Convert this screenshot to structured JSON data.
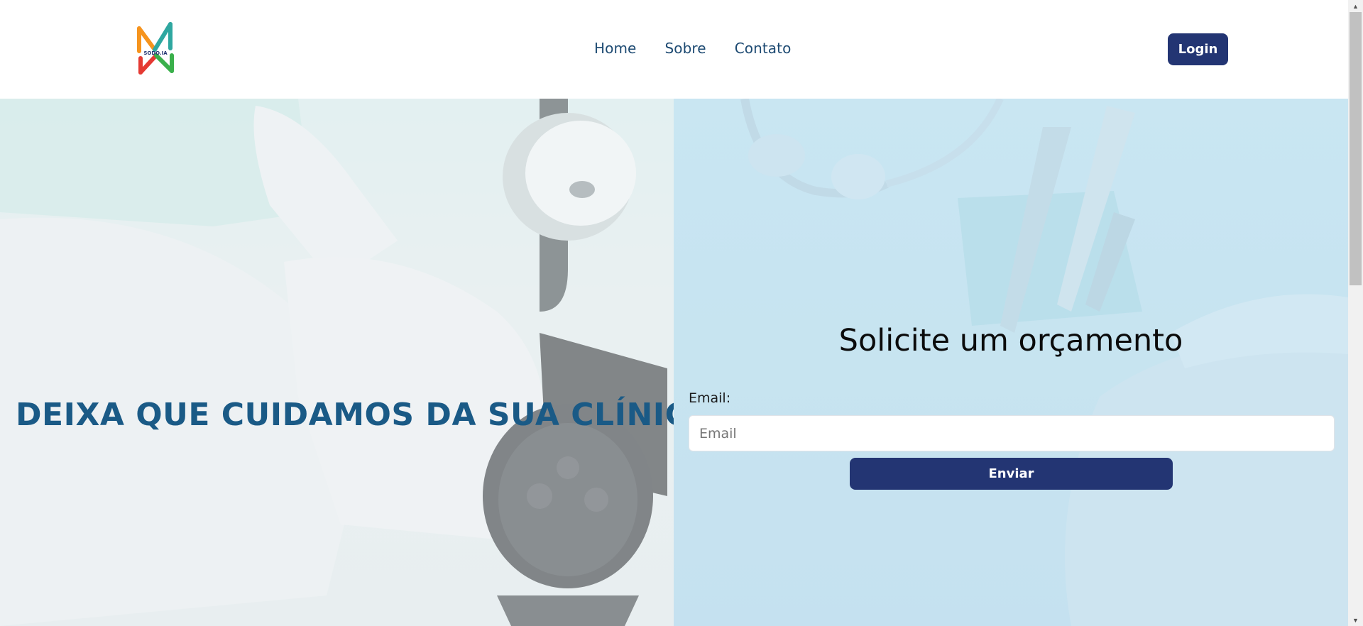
{
  "header": {
    "logo_text": "SODO.IA",
    "nav": [
      "Home",
      "Sobre",
      "Contato"
    ],
    "login_label": "Login"
  },
  "hero": {
    "headline": "DEIXA QUE CUIDAMOS DA SUA CLÍNICA!"
  },
  "quote_form": {
    "title": "Solicite um orçamento",
    "email_label": "Email:",
    "email_placeholder": "Email",
    "email_value": "",
    "submit_label": "Enviar"
  },
  "colors": {
    "brand_navy": "#233573",
    "nav_text": "#1d4a72",
    "headline": "#1a5a86"
  }
}
